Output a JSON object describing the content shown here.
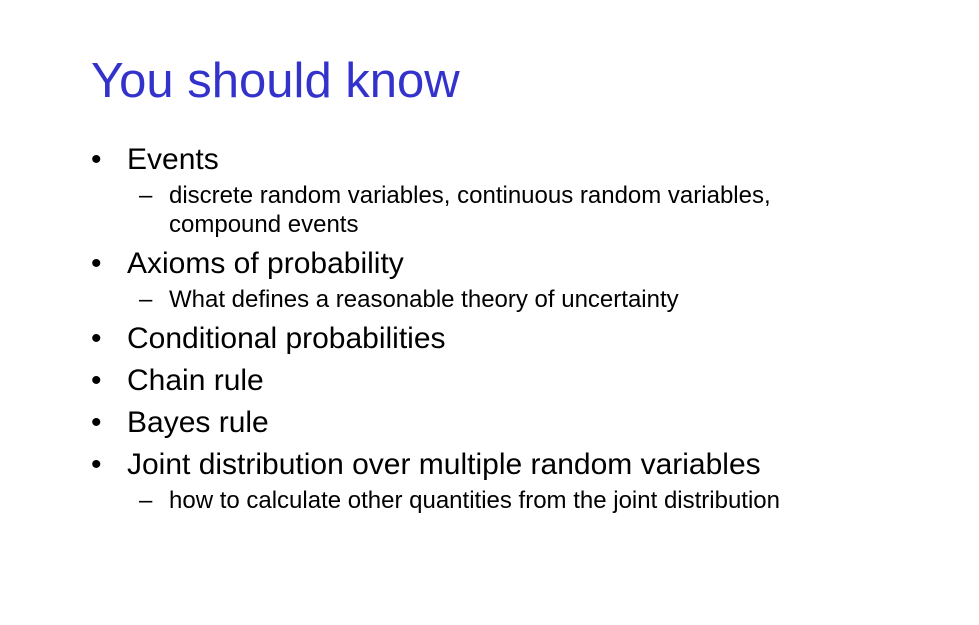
{
  "slide": {
    "title": "You should know",
    "title_color": "#3333cc",
    "bullet_glyph": "•",
    "sub_bullet_glyph": "–",
    "bullets": [
      {
        "text": "Events",
        "sub": [
          "discrete random variables, continuous random variables, compound events"
        ]
      },
      {
        "text": "Axioms of probability",
        "sub": [
          "What defines a reasonable theory of uncertainty"
        ]
      },
      {
        "text": "Conditional probabilities",
        "sub": []
      },
      {
        "text": "Chain rule",
        "sub": []
      },
      {
        "text": "Bayes rule",
        "sub": []
      },
      {
        "text": "Joint distribution over multiple random variables",
        "sub": [
          "how to calculate other quantities from the joint distribution"
        ]
      }
    ]
  }
}
